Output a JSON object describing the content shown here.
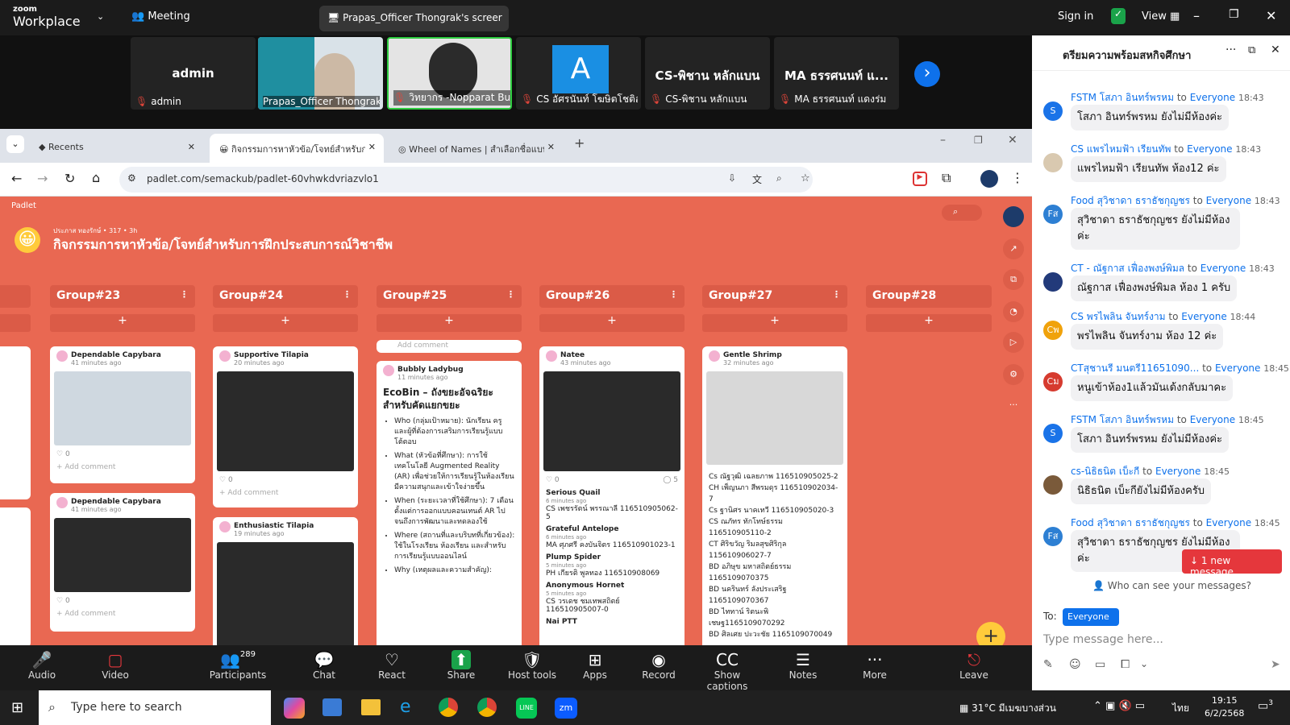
{
  "zoom": {
    "brand_small": "zoom",
    "brand": "Workplace",
    "meeting": "Meeting",
    "share_title": "Prapas_Officer Thongrak's screer",
    "sign_in": "Sign in",
    "view": "View"
  },
  "tiles": [
    {
      "name": "admin",
      "label": "admin"
    },
    {
      "name": "",
      "label": "Prapas_Officer Thongrak"
    },
    {
      "name": "",
      "label": "วิทยากร -Nopparat Budd..."
    },
    {
      "name": "A",
      "label": "CS อัศรนันท์ โฆษิตโชติอ..."
    },
    {
      "name": "CS-พิชาน หลักแบน",
      "label": "CS-พิชาน หลักแบน"
    },
    {
      "name": "MA ธรรศนนท์ แ...",
      "label": "MA ธรรศนนท์ แดงร่ม"
    }
  ],
  "tabs": [
    {
      "label": "Recents"
    },
    {
      "label": "กิจกรรมการหาหัวข้อ/โจทย์สำหรับกา"
    },
    {
      "label": "Wheel of Names | สำเลือกชื่อแบบ"
    }
  ],
  "url": "padlet.com/semackub/padlet-60vhwkdvriazvlo1",
  "padlet": {
    "brand": "Padlet",
    "meta": "ประภาส ทองรักษ์ • 317 • 3h",
    "title": "กิจกรรมการหาหัวข้อ/โจทย์สำหรับการฝึกประสบการณ์วิชาชีพ"
  },
  "groups": [
    "Group#23",
    "Group#24",
    "Group#25",
    "Group#26",
    "Group#27",
    "Group#28"
  ],
  "cards": {
    "c23a": {
      "author": "Dependable Capybara",
      "time": "41 minutes ago",
      "count": "0",
      "add": "Add comment"
    },
    "c23b": {
      "author": "Dependable Capybara",
      "time": "41 minutes ago",
      "count": "0",
      "add": "Add comment"
    },
    "c24a": {
      "author": "Supportive Tilapia",
      "time": "20 minutes ago",
      "count": "0",
      "add": "Add comment"
    },
    "c24b": {
      "author": "Enthusiastic Tilapia",
      "time": "19 minutes ago"
    },
    "c25": {
      "add": "Add comment",
      "author": "Bubbly Ladybug",
      "time": "11 minutes ago",
      "title": "EcoBin – ถังขยะอัจฉริยะสำหรับคัดแยกขยะ",
      "items": [
        "Who (กลุ่มเป้าหมาย): นักเรียน ครู และผู้ที่ต้องการเสริมการเรียนรู้แบบโต้ตอบ",
        "What (หัวข้อที่ศึกษา): การใช้เทคโนโลยี Augmented Reality (AR) เพื่อช่วยให้การเรียนรู้ในห้องเรียนมีความสนุกและเข้าใจง่ายขึ้น",
        "When (ระยะเวลาที่ใช้ศึกษา): 7 เดือน ตั้งแต่การออกแบบคอนเทนต์ AR ไปจนถึงการพัฒนาและทดลองใช้",
        "Where (สถานที่และบริบทที่เกี่ยวข้อง): ใช้ในโรงเรียน ห้องเรียน และสำหรับการเรียนรู้แบบออนไลน์",
        "Why (เหตุผลและความสำคัญ):"
      ]
    },
    "c26": {
      "author": "Natee",
      "time": "43 minutes ago",
      "count": "5",
      "replies": [
        {
          "n": "Serious Quail",
          "t": "6 minutes ago",
          "x": "CS เพชรรัตน์ พรรณาลี 116510905062-5"
        },
        {
          "n": "Grateful Antelope",
          "t": "6 minutes ago",
          "x": "MA ศุภศรี คงบันจิตร 116510901023-1"
        },
        {
          "n": "Plump Spider",
          "t": "5 minutes ago",
          "x": "PH เกียรติ พูลทอง 116510908069"
        },
        {
          "n": "Anonymous Hornet",
          "t": "5 minutes ago",
          "x": "CS วรเดช ชมเทพสถิตย์ 116510905007-0"
        },
        {
          "n": "Nai PTT",
          "t": "",
          "x": ""
        }
      ]
    },
    "c27": {
      "author": "Gentle Shrimp",
      "time": "32 minutes ago",
      "lines": [
        "Cs ณัฐวุฒิ เฉลยภาพ 116510905025-2",
        "CH เพ็ญนภา สีพรมดุร 116510902034-7",
        "Cs ฐานิศร นาคเทวี 116510905020-3",
        "CS ณภัทร ทักโทษ์ธรรม 116510905110-2",
        "CT ศิริขวัญ ริมลสุขศิริกุล 115610906027-7",
        "BD อภิษุข มหาสถิตย์ธรรม 1165109070375",
        "BD นครินทร์ ลังประเสริฐ 1165109070367",
        "BD ไททาน์ ริตนะพิ เชษฐ1165109070292",
        "BD ศิลเศย ปะวะชัย 1165109070049"
      ]
    }
  },
  "chat": {
    "title": "ตรียมความพร้อมสหกิจศึกษา",
    "to_word": "to",
    "messages": [
      {
        "from": "FSTM โสภา อินทร์พรหม",
        "to": "Everyone",
        "time": "18:43",
        "text": "โสภา อินทร์พรหม ยังไม่มีห้องค่ะ",
        "av": "S",
        "col": "#1a73e8"
      },
      {
        "from": "CS แพรไหมฟ้า เรียนทัพ",
        "to": "Everyone",
        "time": "18:43",
        "text": "แพรไหมฟ้า เรียนทัพ ห้อง12 ค่ะ",
        "av": "",
        "col": "#d9c9b0"
      },
      {
        "from": "Food สุวิชาดา ธราธัชกุญชร",
        "to": "Everyone",
        "time": "18:43",
        "text": "สุวิชาดา ธราธัชกุญชร ยังไม่มีห้องค่ะ",
        "av": "Fส",
        "col": "#2d7fd3"
      },
      {
        "from": "CT - ณัฐกาส เฟื่องพงษ์พิมล",
        "to": "Everyone",
        "time": "18:43",
        "text": "ณัฐกาส เฟื่องพงษ์พิมล ห้อง 1 ครับ",
        "av": "",
        "col": "#223a7a"
      },
      {
        "from": "CS พรไพลิน จันทร์งาม",
        "to": "Everyone",
        "time": "18:44",
        "text": "พรไพลิน จันทร์งาม ห้อง 12 ค่ะ",
        "av": "Cพ",
        "col": "#f0a20b"
      },
      {
        "from": "CTสุชานรี มนตรี11651090...",
        "to": "Everyone",
        "time": "18:45",
        "text": "หนูเข้าห้อง1แล้วมันเด้งกลับมาคะ",
        "av": "Cม",
        "col": "#d63b2f"
      },
      {
        "from": "FSTM โสภา อินทร์พรหม",
        "to": "Everyone",
        "time": "18:45",
        "text": "โสภา อินทร์พรหม ยังไม่มีห้องค่ะ",
        "av": "S",
        "col": "#1a73e8"
      },
      {
        "from": "cs-นิธิธนิต เบ็ะกี",
        "to": "Everyone",
        "time": "18:45",
        "text": "นิธิธนิต เบ็ะกียังไม่มีห้องครับ",
        "av": "",
        "col": "#7a5a3a"
      },
      {
        "from": "Food สุวิชาดา ธราธัชกุญชร",
        "to": "Everyone",
        "time": "18:45",
        "text": "สุวิชาดา ธราธัชกุญชร ยังไม่มีห้องค่ะ",
        "av": "Fส",
        "col": "#2d7fd3"
      }
    ],
    "new_message": "1 new message",
    "who": "Who can see your messages?",
    "to_label": "To:",
    "recipient": "Everyone",
    "placeholder": "Type message here..."
  },
  "toolbar": [
    {
      "label": "Audio",
      "icon": "🎤"
    },
    {
      "label": "Video",
      "icon": "▢"
    },
    {
      "label": "Participants",
      "icon": "👥",
      "count": "289"
    },
    {
      "label": "Chat",
      "icon": "💬"
    },
    {
      "label": "React",
      "icon": "♡"
    },
    {
      "label": "Share",
      "icon": "⬆"
    },
    {
      "label": "Host tools",
      "icon": "🛡"
    },
    {
      "label": "Apps",
      "icon": "⊞"
    },
    {
      "label": "Record",
      "icon": "◉"
    },
    {
      "label": "Show captions",
      "icon": "CC"
    },
    {
      "label": "Notes",
      "icon": "☰"
    },
    {
      "label": "More",
      "icon": "···"
    },
    {
      "label": "Leave",
      "icon": "⎋"
    }
  ],
  "taskbar": {
    "search": "Type here to search",
    "weather": "31°C มีเมฆบางส่วน",
    "lang": "ไทย",
    "time": "19:15",
    "date": "6/2/2568",
    "notif": "3"
  }
}
